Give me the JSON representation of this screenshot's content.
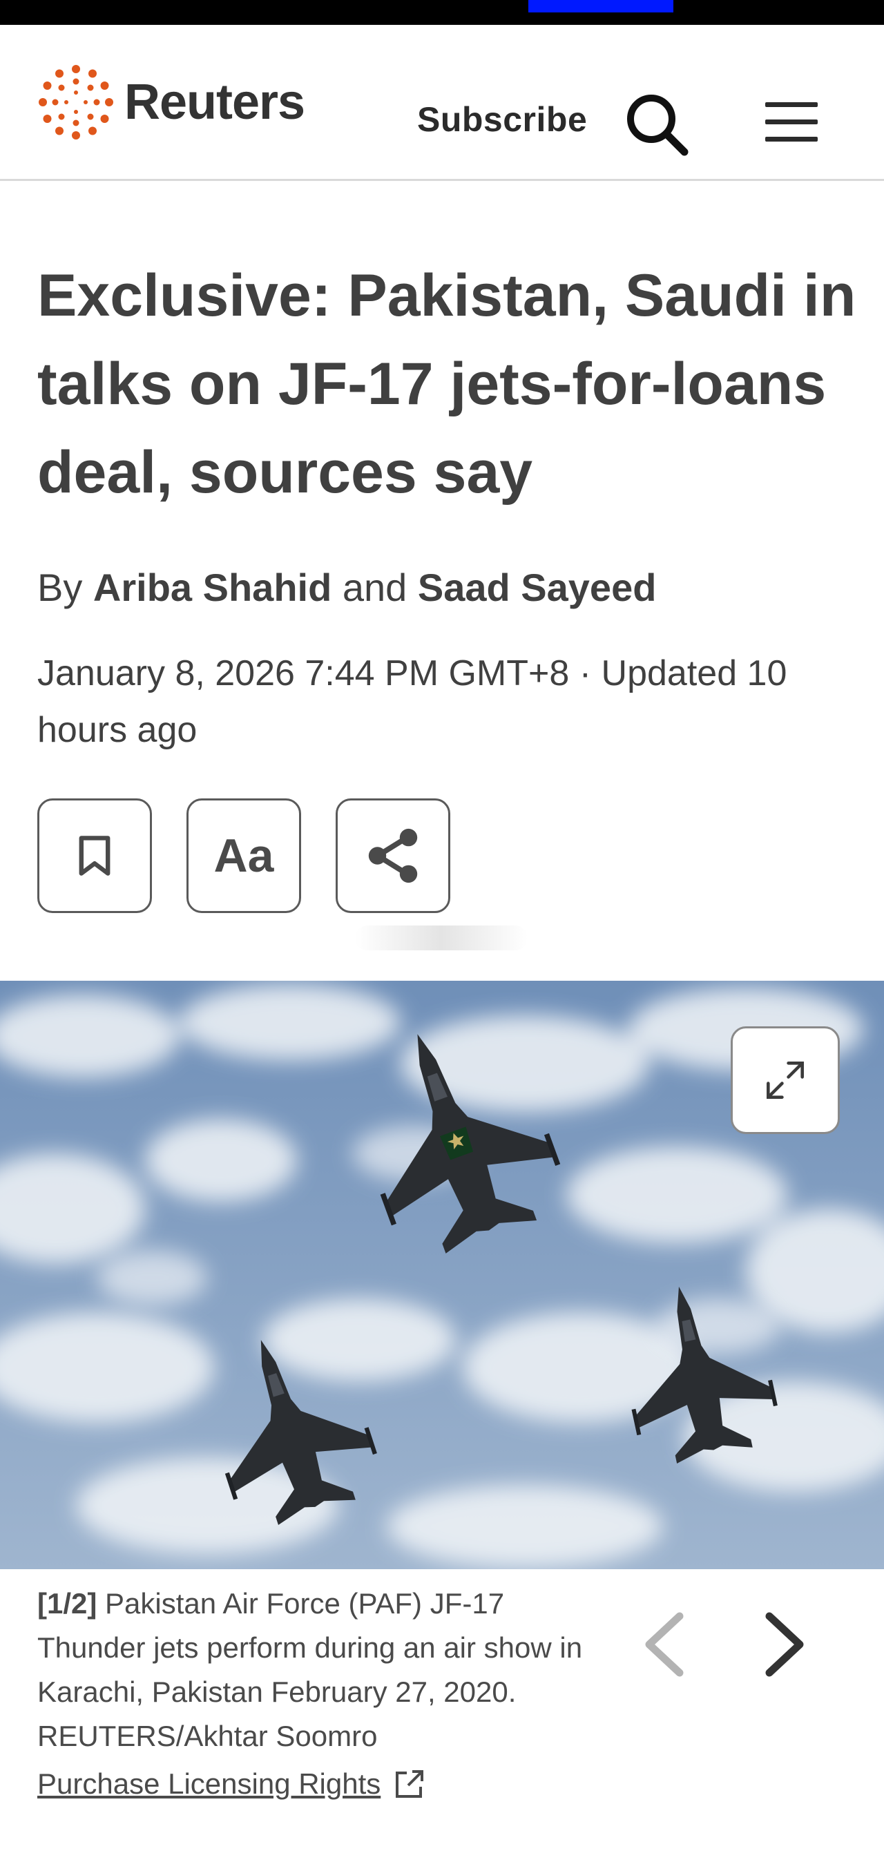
{
  "brand": {
    "name": "Reuters",
    "logo_color": "#e0571b"
  },
  "header": {
    "subscribe_label": "Subscribe",
    "search_icon": "search-icon",
    "menu_icon": "hamburger-menu-icon"
  },
  "article": {
    "headline": "Exclusive: Pakistan, Saudi in talks on JF-17 jets-for-loans deal, sources say",
    "byline_prefix": "By",
    "author_1": "Ariba Shahid",
    "byline_conjunction": "and",
    "author_2": "Saad Sayeed",
    "dateline": "January 8, 2026 7:44 PM GMT+8 · Updated 10 hours ago"
  },
  "toolbar": {
    "text_size_label": "Aa",
    "bookmark_icon": "bookmark-icon",
    "share_icon": "share-icon"
  },
  "photo": {
    "counter": "[1/2]",
    "caption": "Pakistan Air Force (PAF) JF-17 Thunder jets perform during an air show in Karachi, Pakistan February 27, 2020. REUTERS/Akhtar Soomro",
    "licensing_label": "Purchase Licensing Rights",
    "expand_icon": "expand-icon",
    "prev_icon": "chevron-left-icon",
    "next_icon": "chevron-right-icon"
  }
}
